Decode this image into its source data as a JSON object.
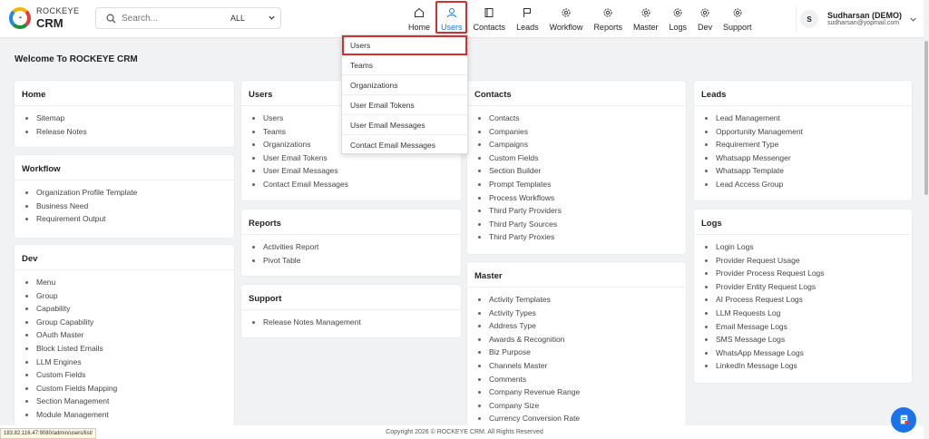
{
  "brand": {
    "line1": "ROCKEYE",
    "line2": "CRM",
    "logo_text": "•••"
  },
  "search": {
    "placeholder": "Search...",
    "scope": "ALL"
  },
  "nav": [
    {
      "label": "Home",
      "icon": "home-icon"
    },
    {
      "label": "Users",
      "icon": "user-icon",
      "active": true
    },
    {
      "label": "Contacts",
      "icon": "contacts-icon"
    },
    {
      "label": "Leads",
      "icon": "flag-icon"
    },
    {
      "label": "Workflow",
      "icon": "gear-icon"
    },
    {
      "label": "Reports",
      "icon": "gear-icon"
    },
    {
      "label": "Master",
      "icon": "gear-icon"
    },
    {
      "label": "Logs",
      "icon": "gear-icon"
    },
    {
      "label": "Dev",
      "icon": "gear-icon"
    },
    {
      "label": "Support",
      "icon": "gear-icon"
    }
  ],
  "user": {
    "initial": "S",
    "name": "Sudharsan (DEMO)",
    "email": "sudharsan@yopmail.com"
  },
  "welcome": "Welcome To ROCKEYE CRM",
  "dropdown": [
    "Users",
    "Teams",
    "Organizations",
    "User Email Tokens",
    "User Email Messages",
    "Contact Email Messages"
  ],
  "cards": {
    "home": {
      "title": "Home",
      "items": [
        "Sitemap",
        "Release Notes"
      ]
    },
    "workflow": {
      "title": "Workflow",
      "items": [
        "Organization Profile Template",
        "Business Need",
        "Requirement Output"
      ]
    },
    "dev": {
      "title": "Dev",
      "items": [
        "Menu",
        "Group",
        "Capability",
        "Group Capability",
        "OAuth Master",
        "Block Listed Emails",
        "LLM Engines",
        "Custom Fields",
        "Custom Fields Mapping",
        "Section Management",
        "Module Management"
      ]
    },
    "users": {
      "title": "Users",
      "items": [
        "Users",
        "Teams",
        "Organizations",
        "User Email Tokens",
        "User Email Messages",
        "Contact Email Messages"
      ]
    },
    "reports": {
      "title": "Reports",
      "items": [
        "Activities Report",
        "Pivot Table"
      ]
    },
    "support": {
      "title": "Support",
      "items": [
        "Release Notes Management"
      ]
    },
    "contacts": {
      "title": "Contacts",
      "items": [
        "Contacts",
        "Companies",
        "Campaigns",
        "Custom Fields",
        "Section Builder",
        "Prompt Templates",
        "Process Workflows",
        "Third Party Providers",
        "Third Party Sources",
        "Third Party Proxies"
      ]
    },
    "master": {
      "title": "Master",
      "items": [
        "Activity Templates",
        "Activity Types",
        "Address Type",
        "Awards & Recognition",
        "Biz Purpose",
        "Channels Master",
        "Comments",
        "Company Revenue Range",
        "Company Size",
        "Currency Conversion Rate"
      ]
    },
    "leads": {
      "title": "Leads",
      "items": [
        "Lead Management",
        "Opportunity Management",
        "Requirement Type",
        "Whatsapp Messenger",
        "Whatsapp Template",
        "Lead Access Group"
      ]
    },
    "logs": {
      "title": "Logs",
      "items": [
        "Login Logs",
        "Provider Request Usage",
        "Provider Process Request Logs",
        "Provider Entity Request Logs",
        "AI Process Request Logs",
        "LLM Requests Log",
        "Email Message Logs",
        "SMS Message Logs",
        "WhatsApp Message Logs",
        "LinkedIn Message Logs"
      ]
    }
  },
  "footer": "Copyright 2026 © ROCKEYE CRM. All Rights Reserved",
  "status_url": "183.82.116.47:9080/admin/users/list/",
  "colors": {
    "accent": "#1a73e8",
    "highlight": "#d32f2f"
  }
}
